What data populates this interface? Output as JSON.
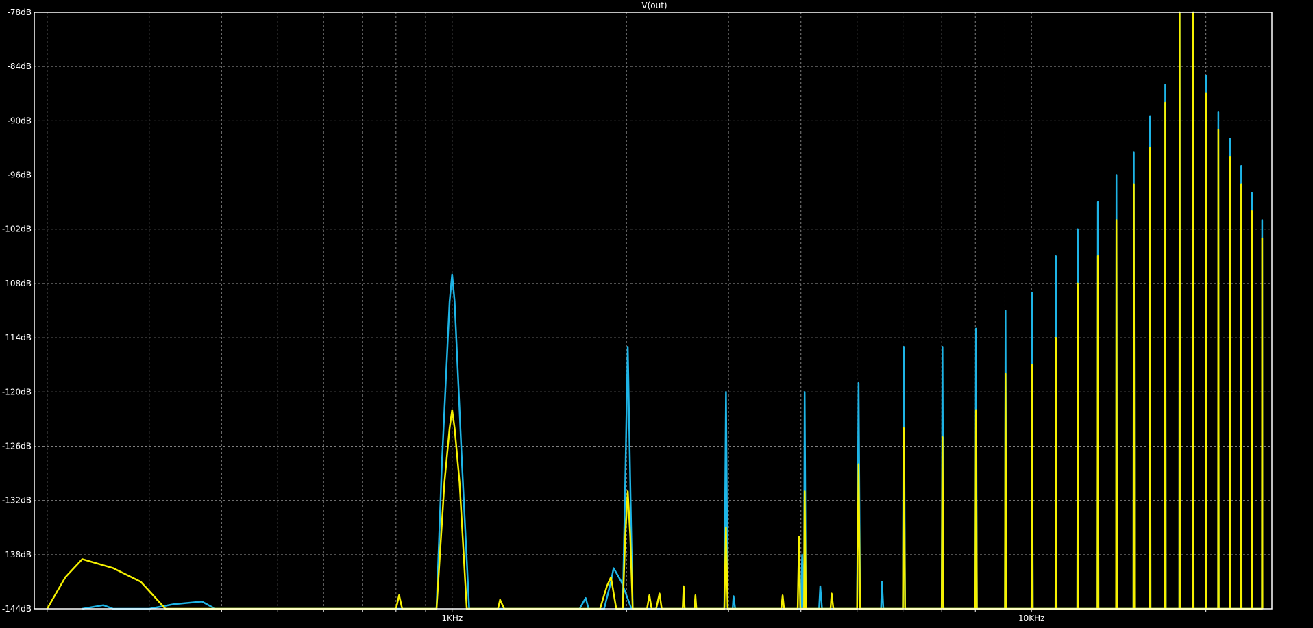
{
  "window": {
    "title": "V(out)"
  },
  "colors": {
    "background": "#000000",
    "grid": "#7f7f7f",
    "axis": "#ffffff",
    "series_cyan": "#1eb4e6",
    "series_yellow": "#f5f000"
  },
  "chart_data": {
    "type": "line",
    "title": "V(out)",
    "xlabel": "",
    "ylabel": "",
    "xscale": "log",
    "xlim": [
      190,
      26000
    ],
    "ylim": [
      -144,
      -78
    ],
    "xticks": [
      {
        "value": 1000,
        "label": "1KHz"
      },
      {
        "value": 10000,
        "label": "10KHz"
      }
    ],
    "yticks": [
      {
        "value": -78,
        "label": "-78dB"
      },
      {
        "value": -84,
        "label": "-84dB"
      },
      {
        "value": -90,
        "label": "-90dB"
      },
      {
        "value": -96,
        "label": "-96dB"
      },
      {
        "value": -102,
        "label": "-102dB"
      },
      {
        "value": -108,
        "label": "-108dB"
      },
      {
        "value": -114,
        "label": "-114dB"
      },
      {
        "value": -120,
        "label": "-120dB"
      },
      {
        "value": -126,
        "label": "-126dB"
      },
      {
        "value": -132,
        "label": "-132dB"
      },
      {
        "value": -138,
        "label": "-138dB"
      },
      {
        "value": -144,
        "label": "-144dB"
      }
    ],
    "grid": true,
    "legend": "none",
    "series": [
      {
        "color": "#1eb4e6",
        "points": [
          [
            230,
            -144
          ],
          [
            250,
            -143.6
          ],
          [
            260,
            -144
          ],
          [
            300,
            -144
          ],
          [
            330,
            -143.5
          ],
          [
            370,
            -143.2
          ],
          [
            390,
            -144
          ],
          [
            940,
            -144
          ],
          [
            960,
            -128
          ],
          [
            990,
            -110
          ],
          [
            1000,
            -107
          ],
          [
            1010,
            -110
          ],
          [
            1040,
            -128
          ],
          [
            1070,
            -144
          ],
          [
            1660,
            -144
          ],
          [
            1700,
            -142.8
          ],
          [
            1720,
            -144
          ],
          [
            1830,
            -144
          ],
          [
            1880,
            -141
          ],
          [
            1900,
            -139.5
          ],
          [
            1960,
            -141
          ],
          [
            2040,
            -144
          ],
          [
            1970,
            -144
          ],
          [
            1990,
            -130
          ],
          [
            2010,
            -115
          ],
          [
            2030,
            -130
          ],
          [
            2050,
            -144
          ],
          [
            2950,
            -144
          ],
          [
            2970,
            -120
          ],
          [
            2990,
            -144
          ],
          [
            3050,
            -144
          ],
          [
            3060,
            -142.6
          ],
          [
            3080,
            -144
          ],
          [
            4000,
            -144
          ],
          [
            4020,
            -138
          ],
          [
            4040,
            -144
          ],
          [
            4050,
            -144
          ],
          [
            4060,
            -120
          ],
          [
            4080,
            -144
          ],
          [
            4300,
            -144
          ],
          [
            4320,
            -141.5
          ],
          [
            4350,
            -144
          ],
          [
            5000,
            -144
          ],
          [
            5030,
            -119
          ],
          [
            5060,
            -144
          ],
          [
            5500,
            -144
          ],
          [
            5520,
            -141
          ],
          [
            5550,
            -144
          ],
          [
            6000,
            -144
          ],
          [
            6020,
            -115
          ],
          [
            6050,
            -144
          ],
          [
            7000,
            -144
          ],
          [
            7020,
            -115
          ],
          [
            7050,
            -144
          ],
          [
            8000,
            -144
          ],
          [
            8020,
            -113
          ],
          [
            8050,
            -144
          ],
          [
            9000,
            -144
          ],
          [
            9020,
            -111
          ],
          [
            9050,
            -144
          ],
          [
            10000,
            -144
          ],
          [
            10020,
            -109
          ],
          [
            10050,
            -144
          ],
          [
            11000,
            -144
          ],
          [
            11020,
            -105
          ],
          [
            11050,
            -144
          ],
          [
            12000,
            -144
          ],
          [
            12020,
            -102
          ],
          [
            12050,
            -144
          ],
          [
            13000,
            -144
          ],
          [
            13020,
            -99
          ],
          [
            13050,
            -144
          ],
          [
            14000,
            -144
          ],
          [
            14020,
            -96
          ],
          [
            14050,
            -144
          ],
          [
            15000,
            -144
          ],
          [
            15020,
            -93.5
          ],
          [
            15050,
            -144
          ],
          [
            16000,
            -144
          ],
          [
            16020,
            -89.5
          ],
          [
            16050,
            -144
          ],
          [
            17000,
            -144
          ],
          [
            17020,
            -86
          ],
          [
            17050,
            -144
          ],
          [
            18000,
            -144
          ],
          [
            18020,
            -78
          ],
          [
            18050,
            -144
          ],
          [
            19000,
            -144
          ],
          [
            19020,
            -78
          ],
          [
            19050,
            -144
          ],
          [
            20000,
            -144
          ],
          [
            20020,
            -85
          ],
          [
            20050,
            -144
          ],
          [
            21000,
            -144
          ],
          [
            21020,
            -89
          ],
          [
            21050,
            -144
          ],
          [
            22000,
            -144
          ],
          [
            22020,
            -92
          ],
          [
            22050,
            -144
          ],
          [
            23000,
            -144
          ],
          [
            23020,
            -95
          ],
          [
            23050,
            -144
          ],
          [
            24000,
            -144
          ],
          [
            24020,
            -98
          ],
          [
            24050,
            -144
          ],
          [
            25000,
            -144
          ],
          [
            25020,
            -101
          ],
          [
            25050,
            -144
          ]
        ]
      },
      {
        "color": "#f5f000",
        "points": [
          [
            200,
            -144
          ],
          [
            215,
            -140.5
          ],
          [
            230,
            -138.5
          ],
          [
            260,
            -139.5
          ],
          [
            290,
            -141
          ],
          [
            320,
            -144
          ],
          [
            800,
            -144
          ],
          [
            810,
            -142.5
          ],
          [
            820,
            -144
          ],
          [
            940,
            -144
          ],
          [
            970,
            -130
          ],
          [
            990,
            -124
          ],
          [
            1000,
            -122
          ],
          [
            1010,
            -124
          ],
          [
            1030,
            -130
          ],
          [
            1060,
            -144
          ],
          [
            1200,
            -144
          ],
          [
            1210,
            -143
          ],
          [
            1230,
            -144
          ],
          [
            1800,
            -144
          ],
          [
            1850,
            -141.5
          ],
          [
            1880,
            -140.5
          ],
          [
            1920,
            -144
          ],
          [
            1970,
            -144
          ],
          [
            1990,
            -136
          ],
          [
            2010,
            -131
          ],
          [
            2030,
            -136
          ],
          [
            2050,
            -144
          ],
          [
            2170,
            -144
          ],
          [
            2190,
            -142.5
          ],
          [
            2210,
            -144
          ],
          [
            2250,
            -144
          ],
          [
            2280,
            -142.3
          ],
          [
            2300,
            -144
          ],
          [
            2500,
            -144
          ],
          [
            2510,
            -141.5
          ],
          [
            2520,
            -144
          ],
          [
            2620,
            -144
          ],
          [
            2630,
            -142.5
          ],
          [
            2640,
            -144
          ],
          [
            2950,
            -144
          ],
          [
            2970,
            -135
          ],
          [
            2990,
            -144
          ],
          [
            3700,
            -144
          ],
          [
            3720,
            -142.5
          ],
          [
            3740,
            -144
          ],
          [
            3950,
            -144
          ],
          [
            3970,
            -136
          ],
          [
            3990,
            -144
          ],
          [
            4050,
            -144
          ],
          [
            4060,
            -131
          ],
          [
            4080,
            -144
          ],
          [
            4500,
            -144
          ],
          [
            4520,
            -142.3
          ],
          [
            4550,
            -144
          ],
          [
            5000,
            -144
          ],
          [
            5030,
            -128
          ],
          [
            5060,
            -144
          ],
          [
            6000,
            -144
          ],
          [
            6020,
            -124
          ],
          [
            6050,
            -144
          ],
          [
            7000,
            -144
          ],
          [
            7020,
            -125
          ],
          [
            7050,
            -144
          ],
          [
            8000,
            -144
          ],
          [
            8020,
            -122
          ],
          [
            8050,
            -144
          ],
          [
            9000,
            -144
          ],
          [
            9020,
            -118
          ],
          [
            9050,
            -144
          ],
          [
            10000,
            -144
          ],
          [
            10020,
            -117
          ],
          [
            10050,
            -144
          ],
          [
            11000,
            -144
          ],
          [
            11020,
            -114
          ],
          [
            11050,
            -144
          ],
          [
            12000,
            -144
          ],
          [
            12020,
            -108
          ],
          [
            12050,
            -144
          ],
          [
            13000,
            -144
          ],
          [
            13020,
            -105
          ],
          [
            13050,
            -144
          ],
          [
            14000,
            -144
          ],
          [
            14020,
            -101
          ],
          [
            14050,
            -144
          ],
          [
            15000,
            -144
          ],
          [
            15020,
            -97
          ],
          [
            15050,
            -144
          ],
          [
            16000,
            -144
          ],
          [
            16020,
            -93
          ],
          [
            16050,
            -144
          ],
          [
            17000,
            -144
          ],
          [
            17020,
            -88
          ],
          [
            17050,
            -144
          ],
          [
            18000,
            -144
          ],
          [
            18020,
            -78
          ],
          [
            18050,
            -144
          ],
          [
            19000,
            -144
          ],
          [
            19020,
            -78
          ],
          [
            19050,
            -144
          ],
          [
            20000,
            -144
          ],
          [
            20020,
            -87
          ],
          [
            20050,
            -144
          ],
          [
            21000,
            -144
          ],
          [
            21020,
            -91
          ],
          [
            21050,
            -144
          ],
          [
            22000,
            -144
          ],
          [
            22020,
            -94
          ],
          [
            22050,
            -144
          ],
          [
            23000,
            -144
          ],
          [
            23020,
            -97
          ],
          [
            23050,
            -144
          ],
          [
            24000,
            -144
          ],
          [
            24020,
            -100
          ],
          [
            24050,
            -144
          ],
          [
            25000,
            -144
          ],
          [
            25020,
            -103
          ],
          [
            25050,
            -144
          ]
        ]
      }
    ]
  }
}
